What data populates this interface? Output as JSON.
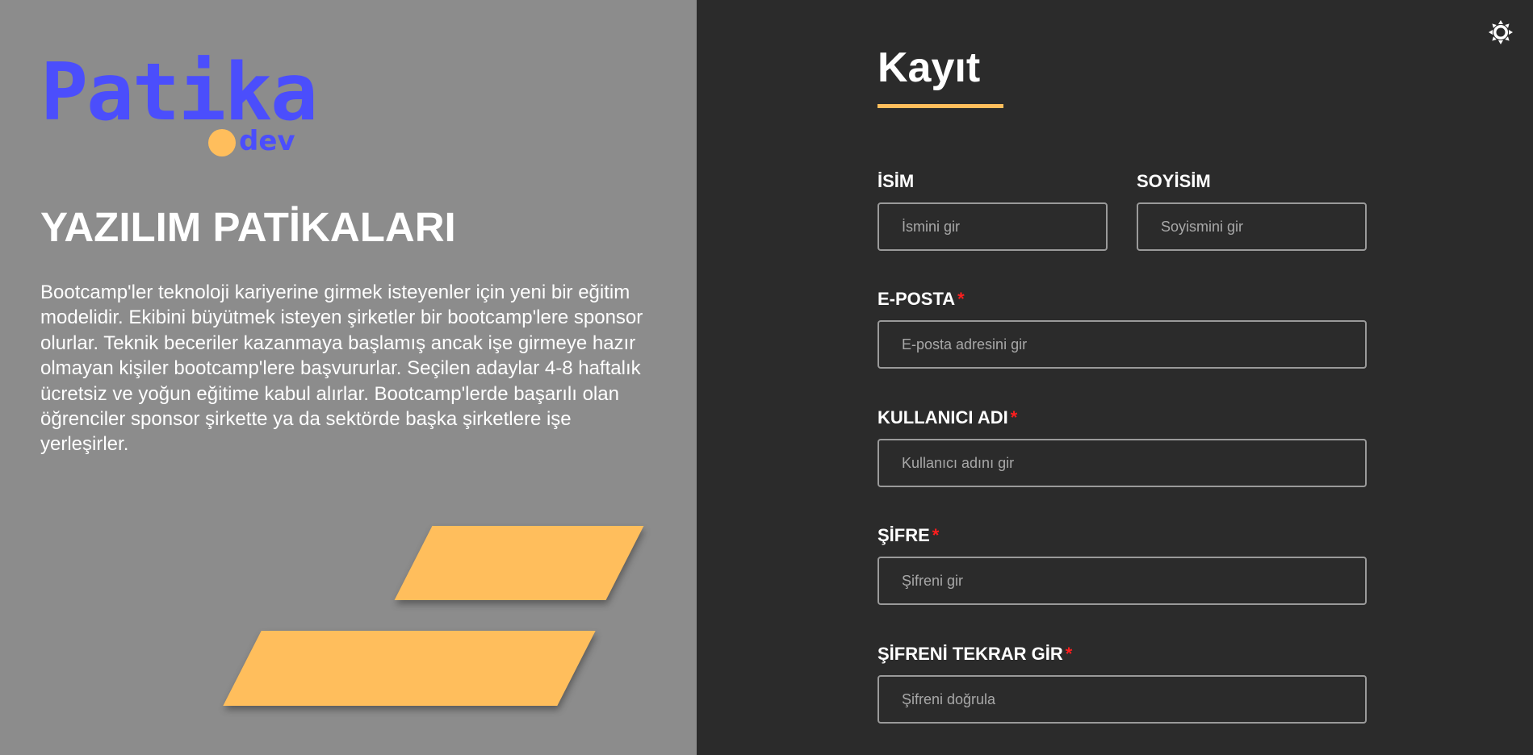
{
  "brand": {
    "logo_text": "Patika",
    "logo_suffix": "dev",
    "accent_color": "#ffbe5c",
    "brand_color": "#4b4efc"
  },
  "left": {
    "title": "YAZILIM PATİKALARI",
    "description": "Bootcamp'ler teknoloji kariyerine girmek isteyenler için yeni bir eğitim modelidir. Ekibini büyütmek isteyen şirketler bir bootcamp'lere sponsor olurlar. Teknik beceriler kazanmaya başlamış ancak işe girmeye hazır olmayan kişiler bootcamp'lere başvururlar. Seçilen adaylar 4-8 haftalık ücretsiz ve yoğun eğitime kabul alırlar. Bootcamp'lerde başarılı olan öğrenciler sponsor şirkette ya da sektörde başka şirketlere işe yerleşirler."
  },
  "theme_toggle": {
    "icon": "sun-icon"
  },
  "form": {
    "title": "Kayıt",
    "required_mark": "*",
    "fields": {
      "first_name": {
        "label": "İSİM",
        "placeholder": "İsmini gir",
        "value": ""
      },
      "last_name": {
        "label": "SOYİSİM",
        "placeholder": "Soyismini gir",
        "value": ""
      },
      "email": {
        "label": "E-POSTA",
        "placeholder": "E-posta adresini gir",
        "value": ""
      },
      "username": {
        "label": "KULLANICI ADI",
        "placeholder": "Kullanıcı adını gir",
        "value": ""
      },
      "password": {
        "label": "ŞİFRE",
        "placeholder": "Şifreni gir",
        "value": ""
      },
      "password_confirm": {
        "label": "ŞİFRENİ TEKRAR GİR",
        "placeholder": "Şifreni doğrula",
        "value": ""
      }
    }
  }
}
